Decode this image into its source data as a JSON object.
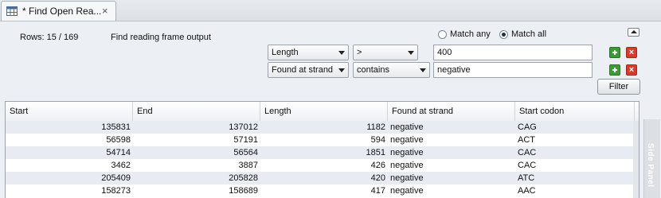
{
  "tab": {
    "title": "* Find Open Rea...",
    "close": "×",
    "icon": "table-icon"
  },
  "header": {
    "rows_label": "Rows: 15 / 169",
    "output_label": "Find reading frame output"
  },
  "match": {
    "any_label": "Match any",
    "all_label": "Match all",
    "selected": "all"
  },
  "filters": [
    {
      "field": "Length",
      "operator": ">",
      "value": "400"
    },
    {
      "field": "Found at strand",
      "operator": "contains",
      "value": "negative"
    }
  ],
  "filter_button": "Filter",
  "table": {
    "columns": [
      "Start",
      "End",
      "Length",
      "Found at strand",
      "Start codon"
    ],
    "rows": [
      [
        "135831",
        "137012",
        "1182",
        "negative",
        "CAG"
      ],
      [
        "56598",
        "57191",
        "594",
        "negative",
        "ACT"
      ],
      [
        "54714",
        "56564",
        "1851",
        "negative",
        "CAC"
      ],
      [
        "3462",
        "3887",
        "426",
        "negative",
        "CAC"
      ],
      [
        "205409",
        "205828",
        "420",
        "negative",
        "ATC"
      ],
      [
        "158273",
        "158689",
        "417",
        "negative",
        "AAC"
      ]
    ]
  },
  "side_panel_label": "Side Panel",
  "colors": {
    "add": "#3e9a38",
    "remove": "#d63b2b",
    "row_alt": "#e8ecf2"
  }
}
